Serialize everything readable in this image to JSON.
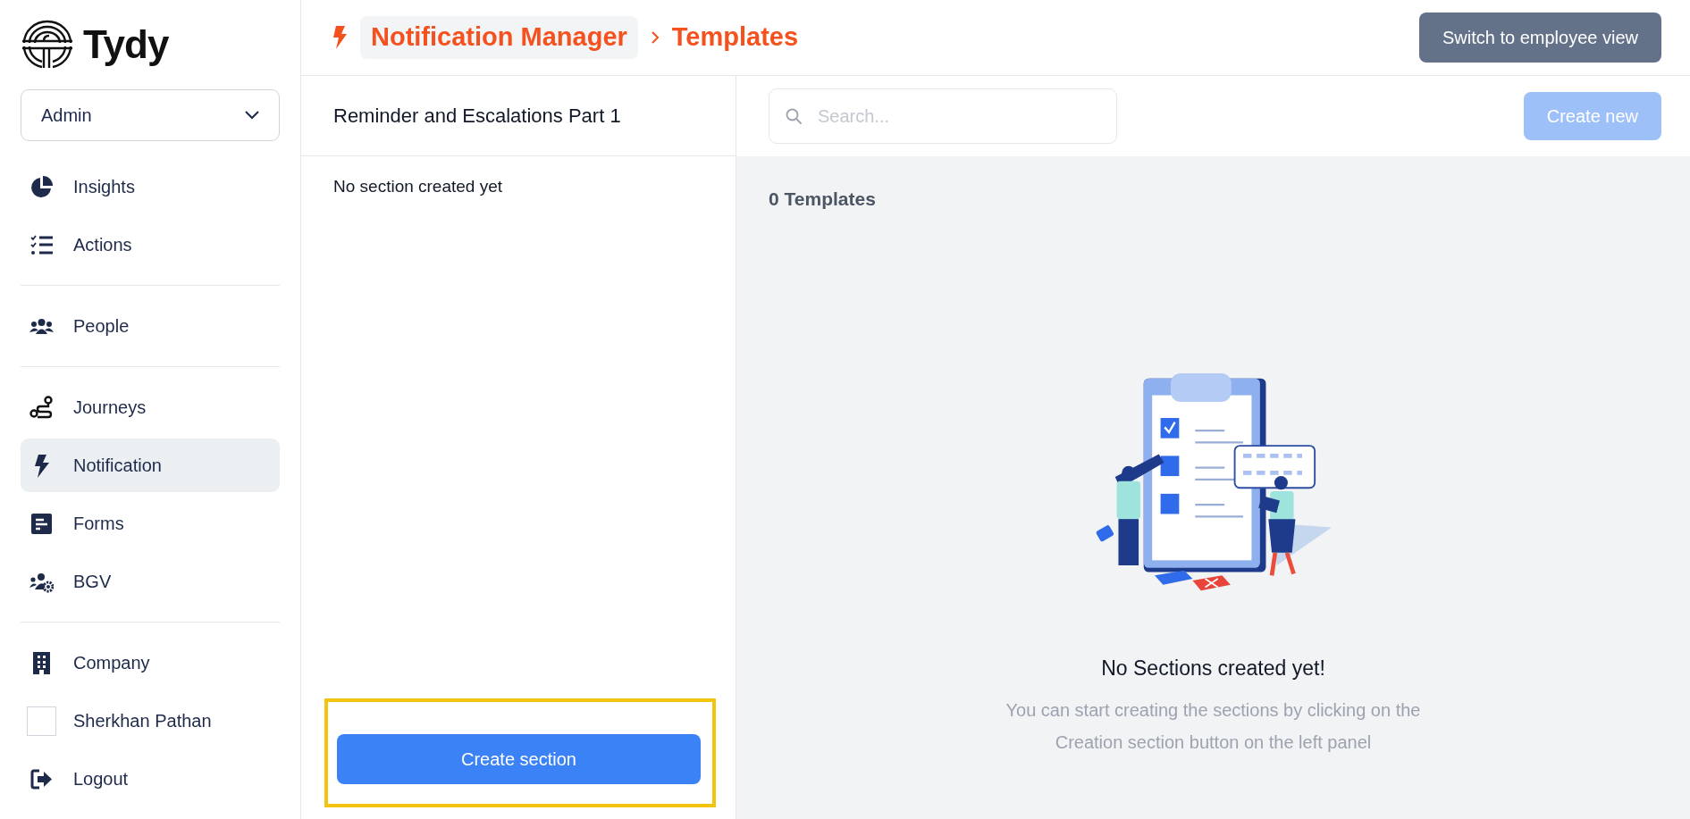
{
  "logo": {
    "text": "Tydy"
  },
  "sidebar": {
    "role_select": {
      "value": "Admin"
    },
    "sections": [
      {
        "items": [
          {
            "kind": "link",
            "label": "Insights",
            "selected": false
          },
          {
            "kind": "link",
            "label": "Actions",
            "selected": false
          }
        ]
      },
      {
        "items": [
          {
            "kind": "link",
            "label": "People",
            "selected": false
          }
        ]
      },
      {
        "items": [
          {
            "kind": "link",
            "label": "Journeys",
            "selected": false
          },
          {
            "kind": "link",
            "label": "Notification",
            "selected": true
          },
          {
            "kind": "link",
            "label": "Forms",
            "selected": false
          },
          {
            "kind": "link",
            "label": "BGV",
            "selected": false
          }
        ]
      },
      {
        "items": [
          {
            "kind": "link",
            "label": "Company",
            "selected": false
          },
          {
            "kind": "profile",
            "label": "Sherkhan Pathan",
            "selected": false
          },
          {
            "kind": "link",
            "label": "Logout",
            "selected": false
          }
        ]
      }
    ]
  },
  "header": {
    "breadcrumb": [
      "Notification Manager",
      "Templates"
    ],
    "switch_button": "Switch to employee view"
  },
  "sections_panel": {
    "title": "Reminder and Escalations Part 1",
    "empty_text": "No section created yet",
    "create_button": {
      "label": "Create section",
      "highlighted": true
    }
  },
  "templates_panel": {
    "search": {
      "placeholder": "Search..."
    },
    "create_button": {
      "label": "Create new",
      "disabled": true
    },
    "count": "0 Templates",
    "empty_state": {
      "title": "No Sections created yet!",
      "text": "You can start creating the sections by clicking on the Creation section button on the left panel"
    }
  }
}
